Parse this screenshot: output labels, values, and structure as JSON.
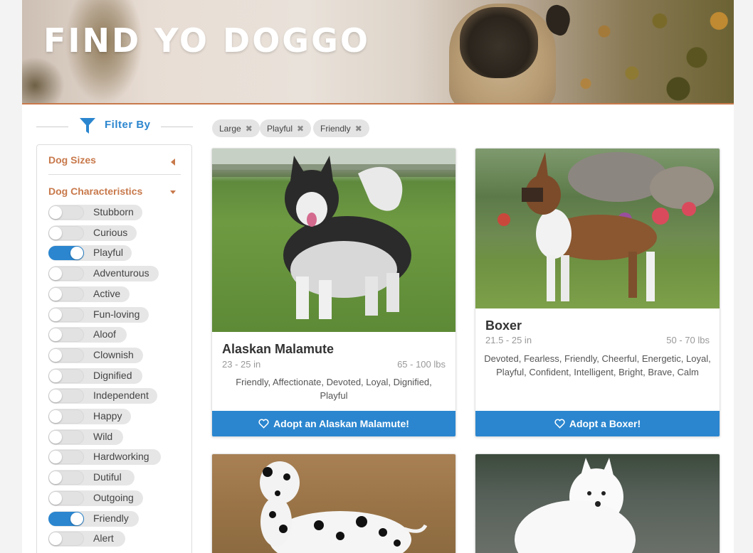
{
  "header": {
    "title": "FIND YO DOGGO"
  },
  "sidebar": {
    "filter_title": "Filter By",
    "sections": {
      "sizes": "Dog Sizes",
      "characteristics": "Dog Characteristics"
    },
    "characteristics": [
      {
        "label": "Stubborn",
        "on": false
      },
      {
        "label": "Curious",
        "on": false
      },
      {
        "label": "Playful",
        "on": true
      },
      {
        "label": "Adventurous",
        "on": false
      },
      {
        "label": "Active",
        "on": false
      },
      {
        "label": "Fun-loving",
        "on": false
      },
      {
        "label": "Aloof",
        "on": false
      },
      {
        "label": "Clownish",
        "on": false
      },
      {
        "label": "Dignified",
        "on": false
      },
      {
        "label": "Independent",
        "on": false
      },
      {
        "label": "Happy",
        "on": false
      },
      {
        "label": "Wild",
        "on": false
      },
      {
        "label": "Hardworking",
        "on": false
      },
      {
        "label": "Dutiful",
        "on": false
      },
      {
        "label": "Outgoing",
        "on": false
      },
      {
        "label": "Friendly",
        "on": true
      },
      {
        "label": "Alert",
        "on": false
      }
    ]
  },
  "active_filters": [
    {
      "label": "Large"
    },
    {
      "label": "Playful"
    },
    {
      "label": "Friendly"
    }
  ],
  "dogs": [
    {
      "name": "Alaskan Malamute",
      "height": "23 - 25 in",
      "weight": "65 - 100 lbs",
      "traits": "Friendly, Affectionate, Devoted, Loyal, Dignified, Playful",
      "adopt_label": "Adopt an Alaskan Malamute!"
    },
    {
      "name": "Boxer",
      "height": "21.5 - 25 in",
      "weight": "50 - 70 lbs",
      "traits": "Devoted, Fearless, Friendly, Cheerful, Energetic, Loyal, Playful, Confident, Intelligent, Bright, Brave, Calm",
      "adopt_label": "Adopt a Boxer!"
    }
  ],
  "colors": {
    "accent": "#2b86cf",
    "section_heading": "#c8794b",
    "hero_border": "#c8794b"
  },
  "icons": {
    "filter": "funnel-icon",
    "remove_tag": "close-icon",
    "adopt": "heart-icon",
    "collapsed": "caret-left-icon",
    "expanded": "caret-down-icon"
  }
}
